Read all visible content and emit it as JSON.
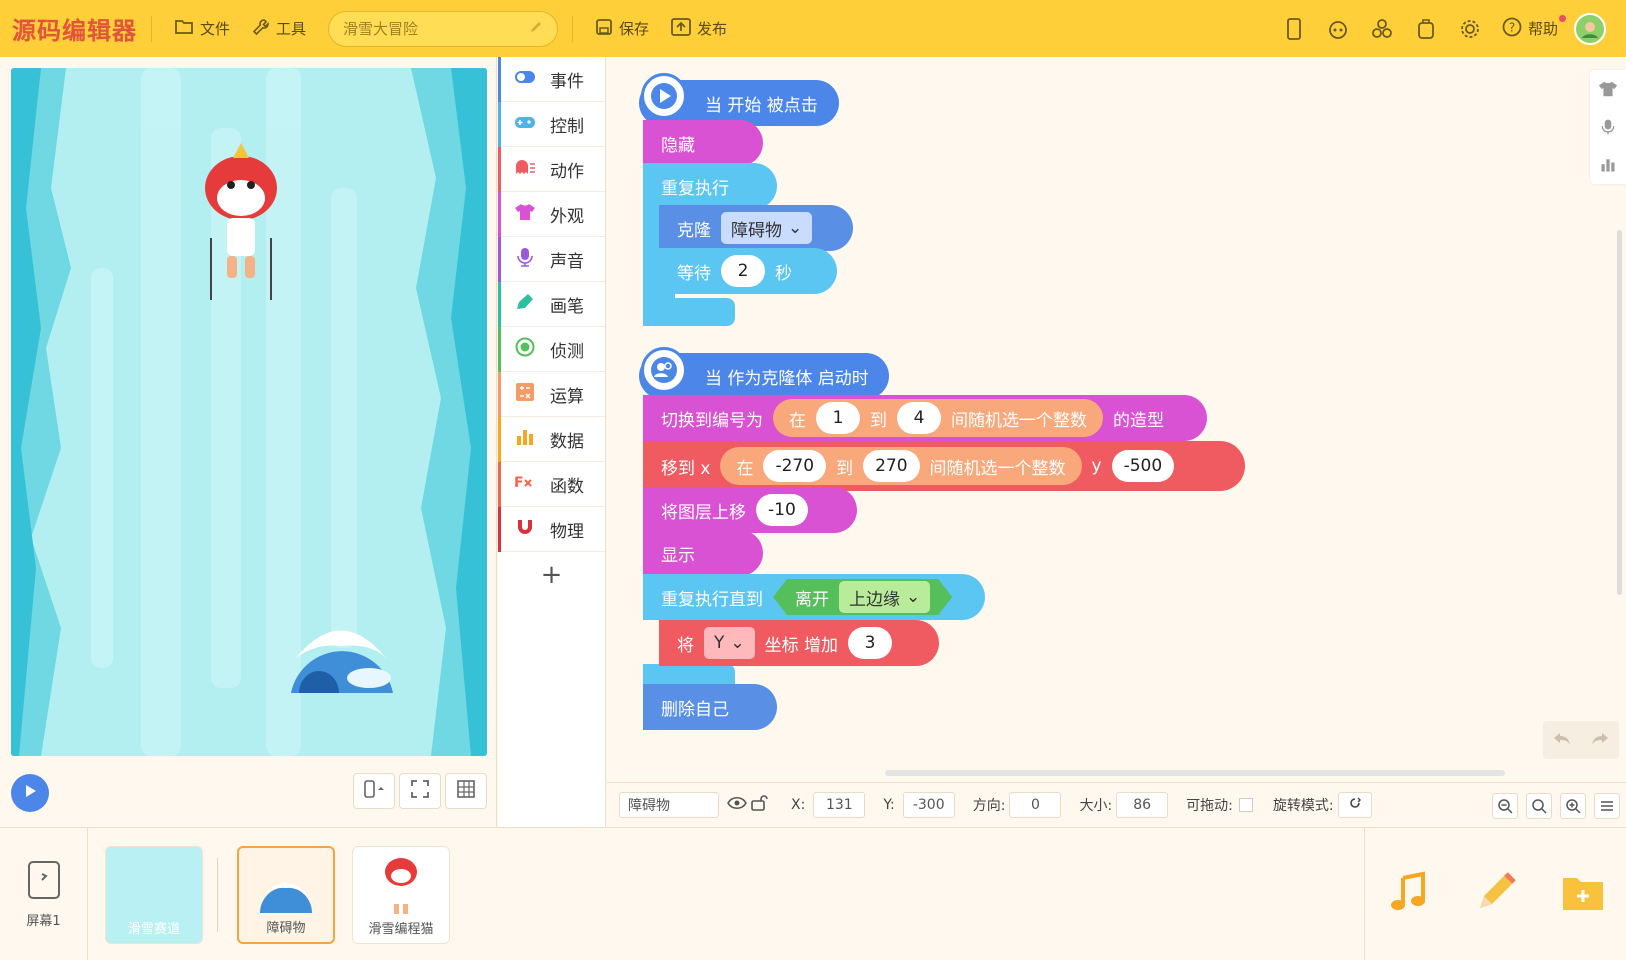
{
  "topbar": {
    "logo": "源码编辑器",
    "file_label": "文件",
    "tools_label": "工具",
    "project_title": "滑雪大冒险",
    "save_label": "保存",
    "publish_label": "发布",
    "help_label": "帮助"
  },
  "categories": [
    {
      "label": "事件",
      "color": "#4c86e8",
      "icon": "toggle-icon"
    },
    {
      "label": "控制",
      "color": "#4fb2e8",
      "icon": "gamepad-icon"
    },
    {
      "label": "动作",
      "color": "#ef5b61",
      "icon": "ghost-icon"
    },
    {
      "label": "外观",
      "color": "#d952d3",
      "icon": "shirt-icon"
    },
    {
      "label": "声音",
      "color": "#9c5ad9",
      "icon": "mic-icon"
    },
    {
      "label": "画笔",
      "color": "#2dbf9f",
      "icon": "pen-icon"
    },
    {
      "label": "侦测",
      "color": "#55c05b",
      "icon": "radar-icon"
    },
    {
      "label": "运算",
      "color": "#f59b68",
      "icon": "calc-icon"
    },
    {
      "label": "数据",
      "color": "#f5a623",
      "icon": "chart-icon"
    },
    {
      "label": "函数",
      "color": "#f0664c",
      "icon": "function-icon"
    },
    {
      "label": "物理",
      "color": "#d7323d",
      "icon": "magnet-icon"
    }
  ],
  "script1": {
    "hat": "当 开始 被点击",
    "hide": "隐藏",
    "repeat": "重复执行",
    "clone": "克隆",
    "clone_target": "障碍物",
    "wait": "等待",
    "wait_value": "2",
    "wait_unit": "秒"
  },
  "script2": {
    "hat": "当 作为克隆体 启动时",
    "switch": "切换到编号为",
    "switch_in": "在",
    "switch_from": "1",
    "switch_to_word": "到",
    "switch_to": "4",
    "switch_random": "间随机选一个整数",
    "switch_suffix": "的造型",
    "move": "移到 x",
    "move_in": "在",
    "move_from": "-270",
    "move_to_word": "到",
    "move_to": "270",
    "move_random": "间随机选一个整数",
    "move_y": "y",
    "move_y_value": "-500",
    "layer": "将图层上移",
    "layer_value": "-10",
    "show": "显示",
    "repeat_until": "重复执行直到",
    "leave": "离开",
    "edge": "上边缘",
    "change_prefix": "将",
    "change_axis": "Y",
    "change_mid": "坐标 增加",
    "change_value": "3",
    "delete": "删除自己"
  },
  "props": {
    "sprite_name": "障碍物",
    "x_label": "X:",
    "x": "131",
    "y_label": "Y:",
    "y": "-300",
    "dir_label": "方向:",
    "dir": "0",
    "size_label": "大小:",
    "size": "86",
    "drag_label": "可拖动:",
    "rot_label": "旋转模式:"
  },
  "sprites": {
    "screen_label": "屏幕1",
    "items": [
      "滑雪赛道",
      "障碍物",
      "滑雪编程猫"
    ]
  },
  "colors": {
    "event": "#4c86e8",
    "control": "#5cc6f2",
    "motion": "#ef5b61",
    "looks": "#d952d3",
    "operator": "#f8a87b",
    "sensing": "#55c05b"
  }
}
